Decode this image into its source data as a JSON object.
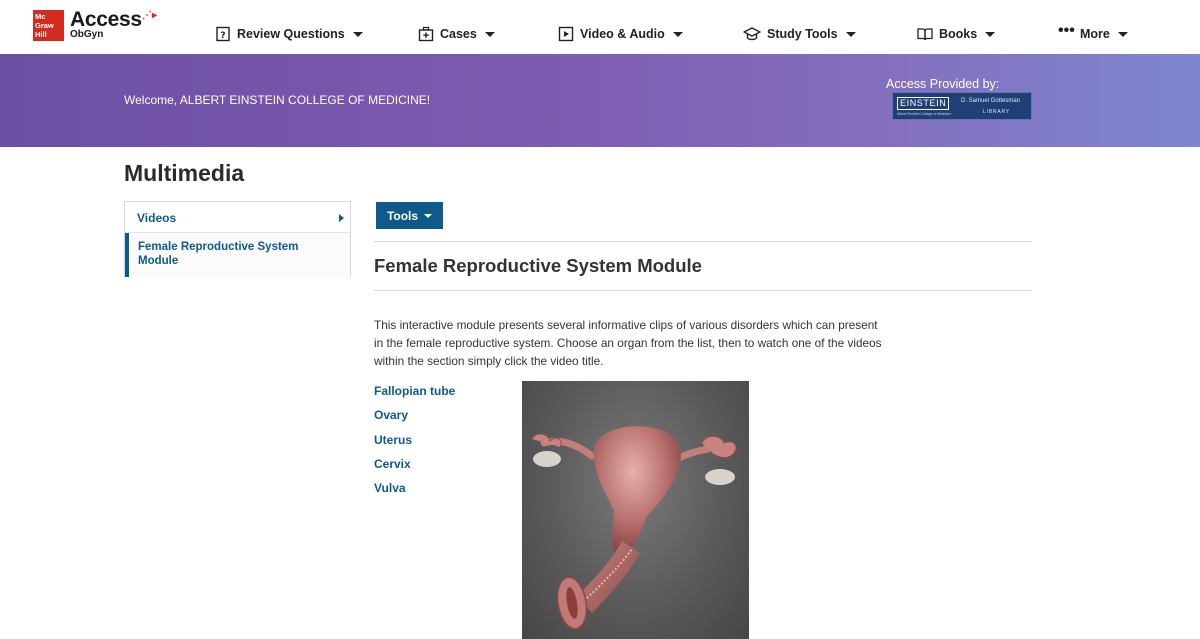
{
  "logo": {
    "parent_lines": [
      "Mc",
      "Graw",
      "Hill"
    ],
    "product": "Access",
    "product_sub": "ObGyn"
  },
  "nav": {
    "items": [
      {
        "label": "Review Questions",
        "icon": "review-questions-icon"
      },
      {
        "label": "Cases",
        "icon": "cases-icon"
      },
      {
        "label": "Video & Audio",
        "icon": "video-icon"
      },
      {
        "label": "Study Tools",
        "icon": "graduation-cap-icon"
      },
      {
        "label": "Books",
        "icon": "book-icon"
      },
      {
        "label": "More",
        "icon": "more-dots-icon"
      }
    ]
  },
  "banner": {
    "welcome": "Welcome, ALBERT EINSTEIN COLLEGE OF MEDICINE!",
    "access_label": "Access Provided by:",
    "library_logo": {
      "name": "EINSTEIN",
      "subtitle": "D. Samuel Gottesman",
      "library": "LIBRARY",
      "small": "Albert Einstein College of Medicine"
    }
  },
  "page": {
    "title": "Multimedia"
  },
  "sidebar": {
    "items": [
      {
        "label": "Videos"
      },
      {
        "label": "Female Reproductive System Module"
      }
    ]
  },
  "main": {
    "tools_label": "Tools",
    "module_title": "Female Reproductive System Module",
    "description": "This interactive module presents several informative clips of various disorders which can present in the female reproductive system. Choose an organ from the list, then to watch one of the videos within the section simply click the video title.",
    "organs": [
      "Fallopian tube",
      "Ovary",
      "Uterus",
      "Cervix",
      "Vulva"
    ]
  },
  "colors": {
    "brand_red": "#d52b1e",
    "link_blue": "#0e5a8a",
    "banner_start": "#6c4fa3",
    "banner_end": "#7d86cf"
  }
}
